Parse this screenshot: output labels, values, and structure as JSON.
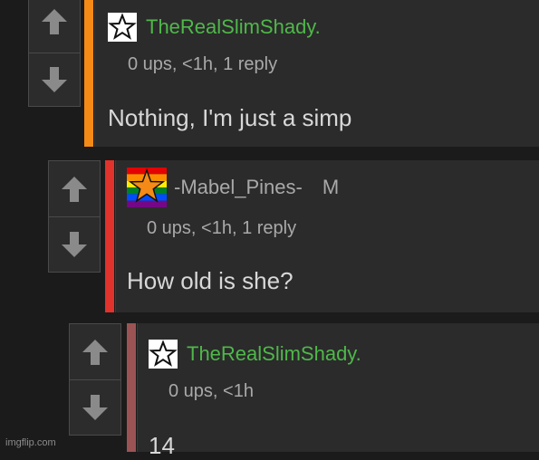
{
  "colors": {
    "accent_orange": "#f58a16",
    "accent_red": "#e2322c",
    "accent_rose": "#9c5353",
    "username_green": "#4fb84a",
    "username_gray": "#a9a9a9"
  },
  "comments": [
    {
      "icon": "star-outline-icon",
      "username": "TheRealSlimShady.",
      "badge": "",
      "meta": "0 ups, <1h, 1 reply",
      "body": "Nothing, I'm just a simp"
    },
    {
      "icon": "rainbow-flag-star-icon",
      "username": "-Mabel_Pines-",
      "badge": "M",
      "meta": "0 ups, <1h, 1 reply",
      "body": "How old is she?"
    },
    {
      "icon": "star-outline-icon",
      "username": "TheRealSlimShady.",
      "badge": "",
      "meta": "0 ups, <1h",
      "body": "14"
    }
  ],
  "watermark": "imgflip.com"
}
